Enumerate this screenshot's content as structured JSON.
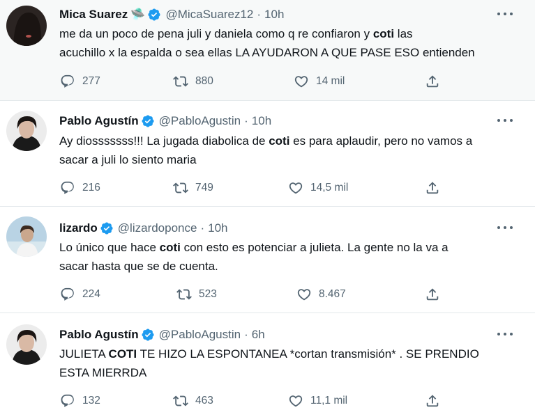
{
  "tweets": [
    {
      "name": "Mica Suarez",
      "badge": "🛸",
      "handle": "@MicaSuarez12",
      "separator": "·",
      "time": "10h",
      "text_lines": [
        [
          "me da un poco de pena juli y daniela como q re confiaron y ",
          "coti",
          " las"
        ],
        [
          "acuchillo x la espalda o sea ellas LA AYUDARON A QUE PASE ESO entienden"
        ]
      ],
      "replies": "277",
      "retweets": "880",
      "likes": "14 mil"
    },
    {
      "name": "Pablo Agustín",
      "handle": "@PabloAgustin",
      "separator": "·",
      "time": "10h",
      "text_lines": [
        [
          "Ay diosssssss!!! La jugada diabolica de ",
          "coti",
          " es para aplaudir, pero no vamos a"
        ],
        [
          "sacar a juli lo siento maria"
        ]
      ],
      "replies": "216",
      "retweets": "749",
      "likes": "14,5 mil"
    },
    {
      "name": "lizardo",
      "handle": "@lizardoponce",
      "separator": "·",
      "time": "10h",
      "text_lines": [
        [
          "Lo único que hace ",
          "coti",
          " con esto es potenciar a julieta. La gente no la va a"
        ],
        [
          "sacar hasta que se de cuenta."
        ]
      ],
      "replies": "224",
      "retweets": "523",
      "likes": "8.467"
    },
    {
      "name": "Pablo Agustín",
      "handle": "@PabloAgustin",
      "separator": "·",
      "time": "6h",
      "text_lines": [
        [
          "JULIETA ",
          "COTI",
          " TE HIZO LA ESPONTANEA *cortan transmisión* . SE PRENDIO"
        ],
        [
          "ESTA MIERRDA"
        ]
      ],
      "replies": "132",
      "retweets": "463",
      "likes": "11,1 mil"
    }
  ],
  "colors": {
    "verified": "#1d9bf0",
    "muted": "#536471",
    "text": "#0f1419",
    "highlight_bg": "#f7f9f9"
  },
  "icons": {
    "verified": "verified-badge-icon",
    "more": "more-dots-icon",
    "reply": "reply-icon",
    "retweet": "retweet-icon",
    "like": "heart-icon",
    "share": "share-icon"
  }
}
